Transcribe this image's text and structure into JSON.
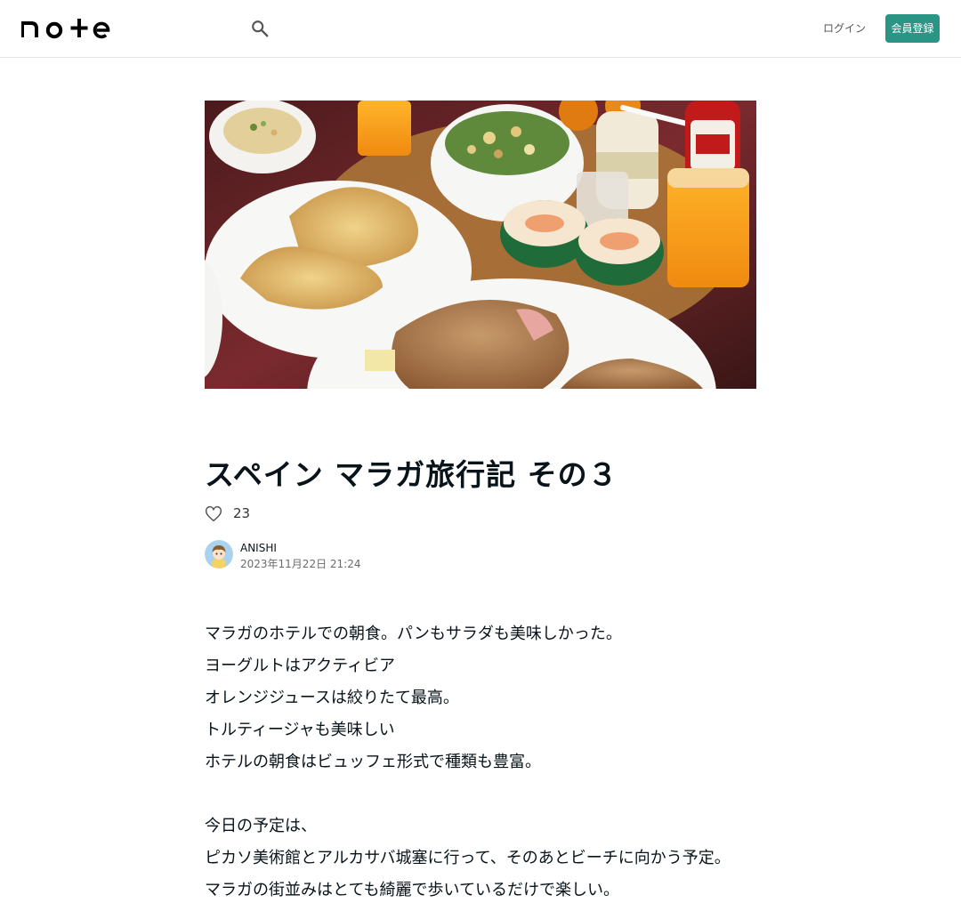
{
  "header": {
    "logo_text": "note",
    "login_label": "ログイン",
    "signup_label": "会員登録"
  },
  "icons": {
    "search": "search-icon",
    "like": "heart-icon",
    "logo": "note-logo"
  },
  "colors": {
    "accent": "#2a9485",
    "text": "#08131a",
    "muted": "#6b6b6b"
  },
  "hero": {
    "alt": "朝食の写真"
  },
  "article": {
    "title": "スペイン マラガ旅行記 その３",
    "like_count": "23",
    "author": "ANISHI",
    "date": "2023年11月22日 21:24",
    "paragraphs": [
      "マラガのホテルでの朝食。パンもサラダも美味しかった。",
      "ヨーグルトはアクティビア",
      "オレンジジュースは絞りたて最高。",
      "トルティージャも美味しい",
      "ホテルの朝食はビュッフェ形式で種類も豊富。",
      "",
      "今日の予定は、",
      "ピカソ美術館とアルカサバ城塞に行って、そのあとビーチに向かう予定。",
      "マラガの街並みはとても綺麗で歩いているだけで楽しい。"
    ]
  }
}
